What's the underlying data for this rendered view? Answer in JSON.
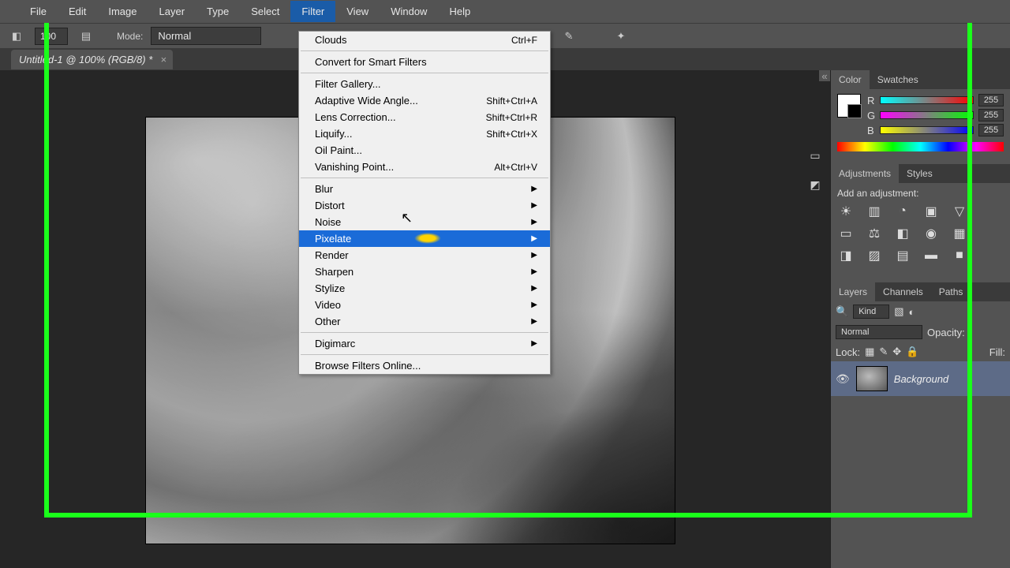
{
  "menubar": [
    "File",
    "Edit",
    "Image",
    "Layer",
    "Type",
    "Select",
    "Filter",
    "View",
    "Window",
    "Help"
  ],
  "optbar": {
    "size": "100",
    "mode_label": "Mode:",
    "mode_value": "Normal"
  },
  "doc_tab": {
    "title": "Untitled-1 @ 100% (RGB/8) *",
    "close": "×"
  },
  "filter_menu": {
    "last": {
      "label": "Clouds",
      "shortcut": "Ctrl+F"
    },
    "convert": "Convert for Smart Filters",
    "group2": [
      {
        "label": "Filter Gallery...",
        "shortcut": ""
      },
      {
        "label": "Adaptive Wide Angle...",
        "shortcut": "Shift+Ctrl+A"
      },
      {
        "label": "Lens Correction...",
        "shortcut": "Shift+Ctrl+R"
      },
      {
        "label": "Liquify...",
        "shortcut": "Shift+Ctrl+X"
      },
      {
        "label": "Oil Paint...",
        "shortcut": ""
      },
      {
        "label": "Vanishing Point...",
        "shortcut": "Alt+Ctrl+V"
      }
    ],
    "submenus": [
      "Blur",
      "Distort",
      "Noise",
      "Pixelate",
      "Render",
      "Sharpen",
      "Stylize",
      "Video",
      "Other"
    ],
    "hovered_index": 3,
    "digimarc": "Digimarc",
    "browse": "Browse Filters Online..."
  },
  "panels": {
    "collapse_glyph": "«",
    "color_tabs": [
      "Color",
      "Swatches"
    ],
    "rgb": {
      "r_label": "R",
      "g_label": "G",
      "b_label": "B",
      "r": "255",
      "g": "255",
      "b": "255"
    },
    "adjustments_tabs": [
      "Adjustments",
      "Styles"
    ],
    "adjustments_text": "Add an adjustment:",
    "layers_tabs": [
      "Layers",
      "Channels",
      "Paths"
    ],
    "layer_kind_label": "Kind",
    "blend_mode": "Normal",
    "opacity_label": "Opacity:",
    "lock_label": "Lock:",
    "fill_label": "Fill:",
    "layer_name": "Background"
  }
}
